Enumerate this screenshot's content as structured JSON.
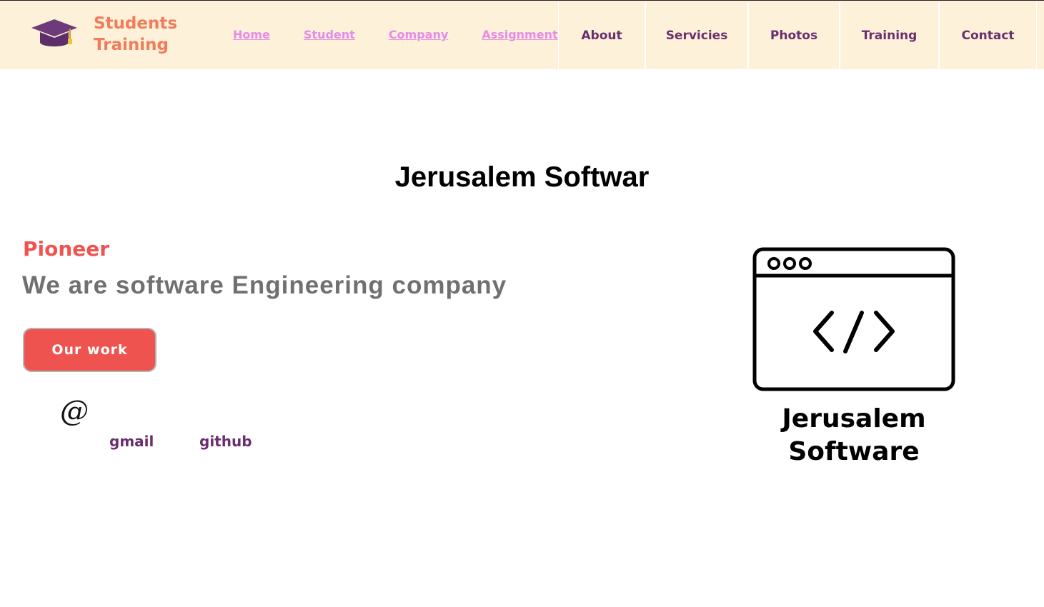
{
  "brand": {
    "line1": "Students",
    "line2": "Training",
    "icon": "graduation-cap-icon"
  },
  "nav_links": [
    {
      "label": "Home"
    },
    {
      "label": "Student"
    },
    {
      "label": "Company"
    },
    {
      "label": "Assignment"
    }
  ],
  "menu": [
    {
      "label": "About"
    },
    {
      "label": "Servicies"
    },
    {
      "label": "Photos"
    },
    {
      "label": "Training"
    },
    {
      "label": "Contact"
    }
  ],
  "page_title": "Jerusalem Softwar",
  "hero": {
    "eyebrow": "Pioneer",
    "tagline": "We are software Engineering company",
    "cta_label": "Our work"
  },
  "contact": {
    "at_symbol": "@",
    "gmail": "gmail",
    "github": "github"
  },
  "illustration": {
    "icon": "code-window-icon",
    "line1": "Jerusalem",
    "line2": "Software"
  },
  "colors": {
    "topbar_bg": "#fef1d9",
    "brand": "#f07c5c",
    "nav_link": "#e58be8",
    "menu_text": "#6a2f6e",
    "accent_red": "#ef5350",
    "tagline_gray": "#707070",
    "social": "#6a2f6e",
    "cap": "#6d3a7a"
  }
}
